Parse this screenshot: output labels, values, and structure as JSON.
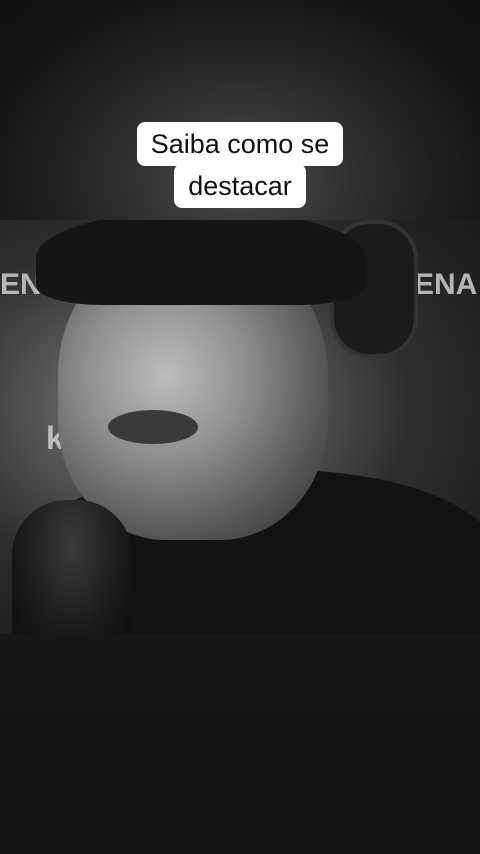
{
  "caption": {
    "line1": "Saiba como se",
    "line2": "destacar"
  },
  "video": {
    "backdrop_letters_left": "ENA",
    "backdrop_letters_right": "ENA",
    "backdrop_small_left": "ko",
    "colors": {
      "caption_bg": "#ffffff",
      "caption_text": "#111111",
      "background": "#0e0e0e"
    }
  }
}
